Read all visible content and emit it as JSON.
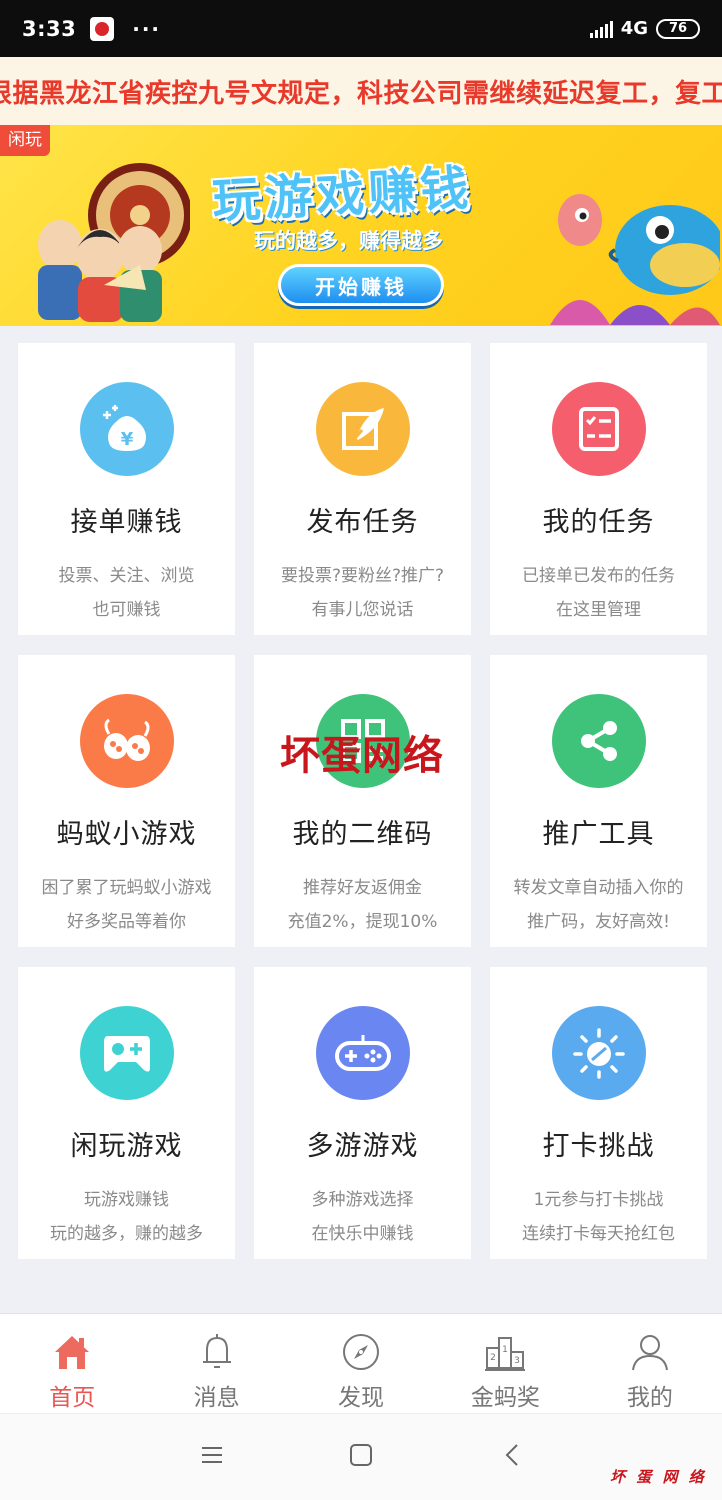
{
  "status_bar": {
    "time": "3:33",
    "more": "···",
    "network": "4G",
    "battery": "76"
  },
  "notice": {
    "text": "根据黑龙江省疾控九号文规定，科技公司需继续延迟复工，复工"
  },
  "banner": {
    "tag": "闲玩",
    "title": "玩游戏赚钱",
    "subtitle": "玩的越多，赚得越多",
    "button": "开始赚钱"
  },
  "cards": [
    {
      "title": "接单赚钱",
      "desc1": "投票、关注、浏览",
      "desc2": "也可赚钱",
      "color": "#5bc0f0",
      "icon": "money-bag-icon"
    },
    {
      "title": "发布任务",
      "desc1": "要投票?要粉丝?推广?",
      "desc2": "有事儿您说话",
      "color": "#f9b73c",
      "icon": "feather-edit-icon"
    },
    {
      "title": "我的任务",
      "desc1": "已接单已发布的任务",
      "desc2": "在这里管理",
      "color": "#f55e6c",
      "icon": "checklist-icon"
    },
    {
      "title": "蚂蚁小游戏",
      "desc1": "困了累了玩蚂蚁小游戏",
      "desc2": "好多奖品等着你",
      "color": "#fb7b48",
      "icon": "ant-game-icon"
    },
    {
      "title": "我的二维码",
      "desc1": "推荐好友返佣金",
      "desc2": "充值2%，提现10%",
      "color": "#3fc27a",
      "icon": "qr-code-icon"
    },
    {
      "title": "推广工具",
      "desc1": "转发文章自动插入你的",
      "desc2": "推广码，友好高效!",
      "color": "#3fc27a",
      "icon": "share-icon"
    },
    {
      "title": "闲玩游戏",
      "desc1": "玩游戏赚钱",
      "desc2": "玩的越多，赚的越多",
      "color": "#3fd2d2",
      "icon": "gamepad-plus-icon"
    },
    {
      "title": "多游游戏",
      "desc1": "多种游戏选择",
      "desc2": "在快乐中赚钱",
      "color": "#6a86f0",
      "icon": "controller-icon"
    },
    {
      "title": "打卡挑战",
      "desc1": "1元参与打卡挑战",
      "desc2": "连续打卡每天抢红包",
      "color": "#5aaaf0",
      "icon": "sun-clock-icon"
    }
  ],
  "watermark": {
    "center": "坏蛋网络",
    "bottom": "坏 蛋 网 络"
  },
  "tabs": [
    {
      "label": "首页",
      "icon": "home-icon",
      "active": true
    },
    {
      "label": "消息",
      "icon": "bell-icon",
      "active": false
    },
    {
      "label": "发现",
      "icon": "compass-icon",
      "active": false
    },
    {
      "label": "金蚂奖",
      "icon": "podium-icon",
      "active": false
    },
    {
      "label": "我的",
      "icon": "user-icon",
      "active": false
    }
  ],
  "colors": {
    "accent": "#e95550",
    "notice_text": "#e8392b",
    "background": "#eef0f5"
  }
}
